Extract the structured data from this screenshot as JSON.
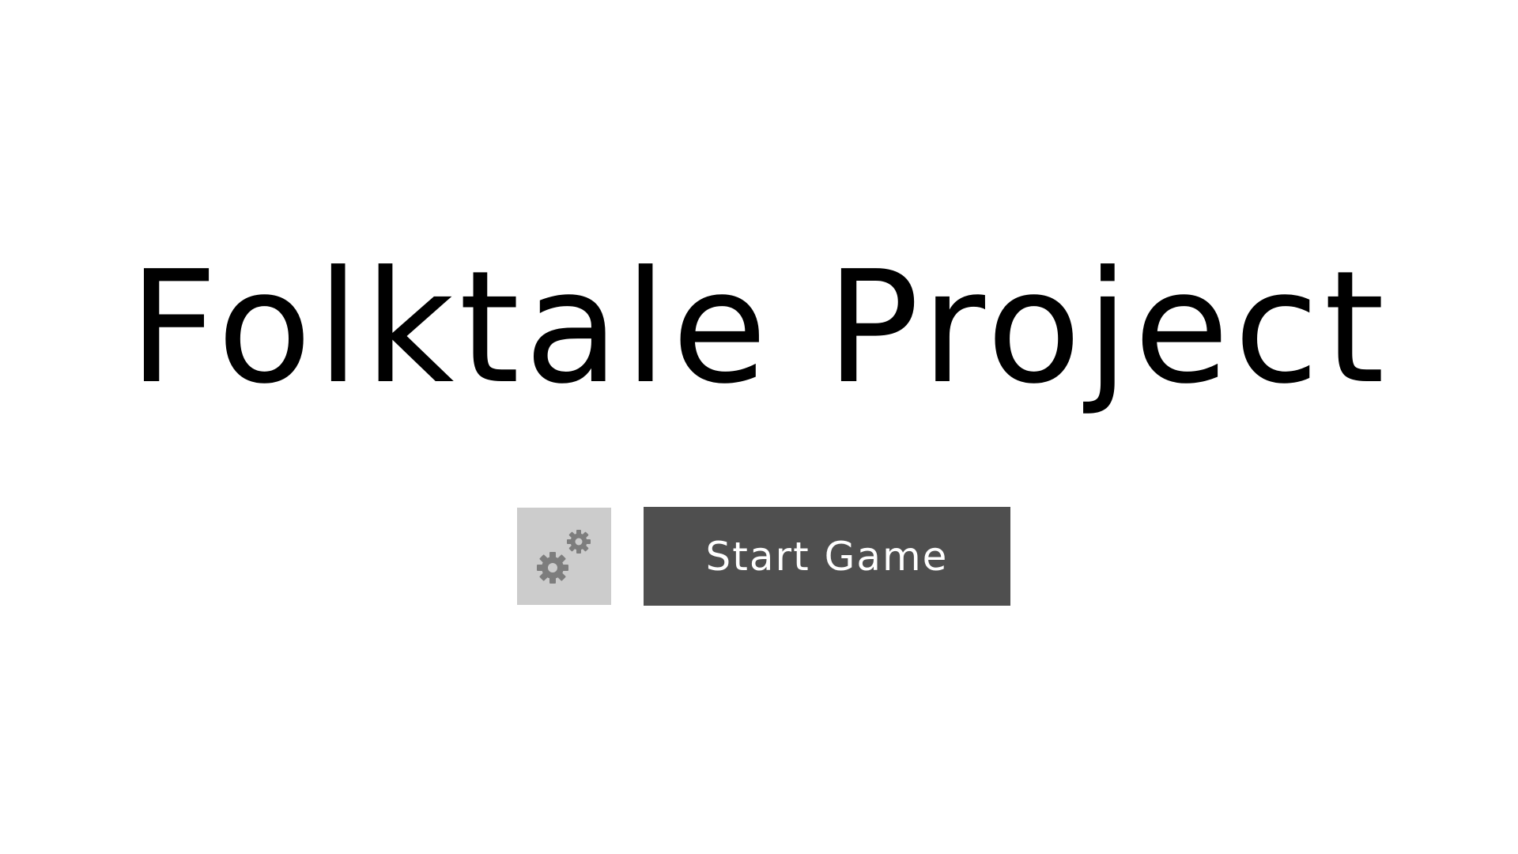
{
  "menu": {
    "title": "Folktale Project",
    "settings_icon": "gears-icon",
    "start_label": "Start Game"
  },
  "colors": {
    "background": "#ffffff",
    "title": "#000000",
    "settings_button_bg": "#cccccc",
    "settings_icon": "#7d7d7d",
    "start_button_bg": "#4f4f4f",
    "start_button_text": "#ffffff"
  }
}
